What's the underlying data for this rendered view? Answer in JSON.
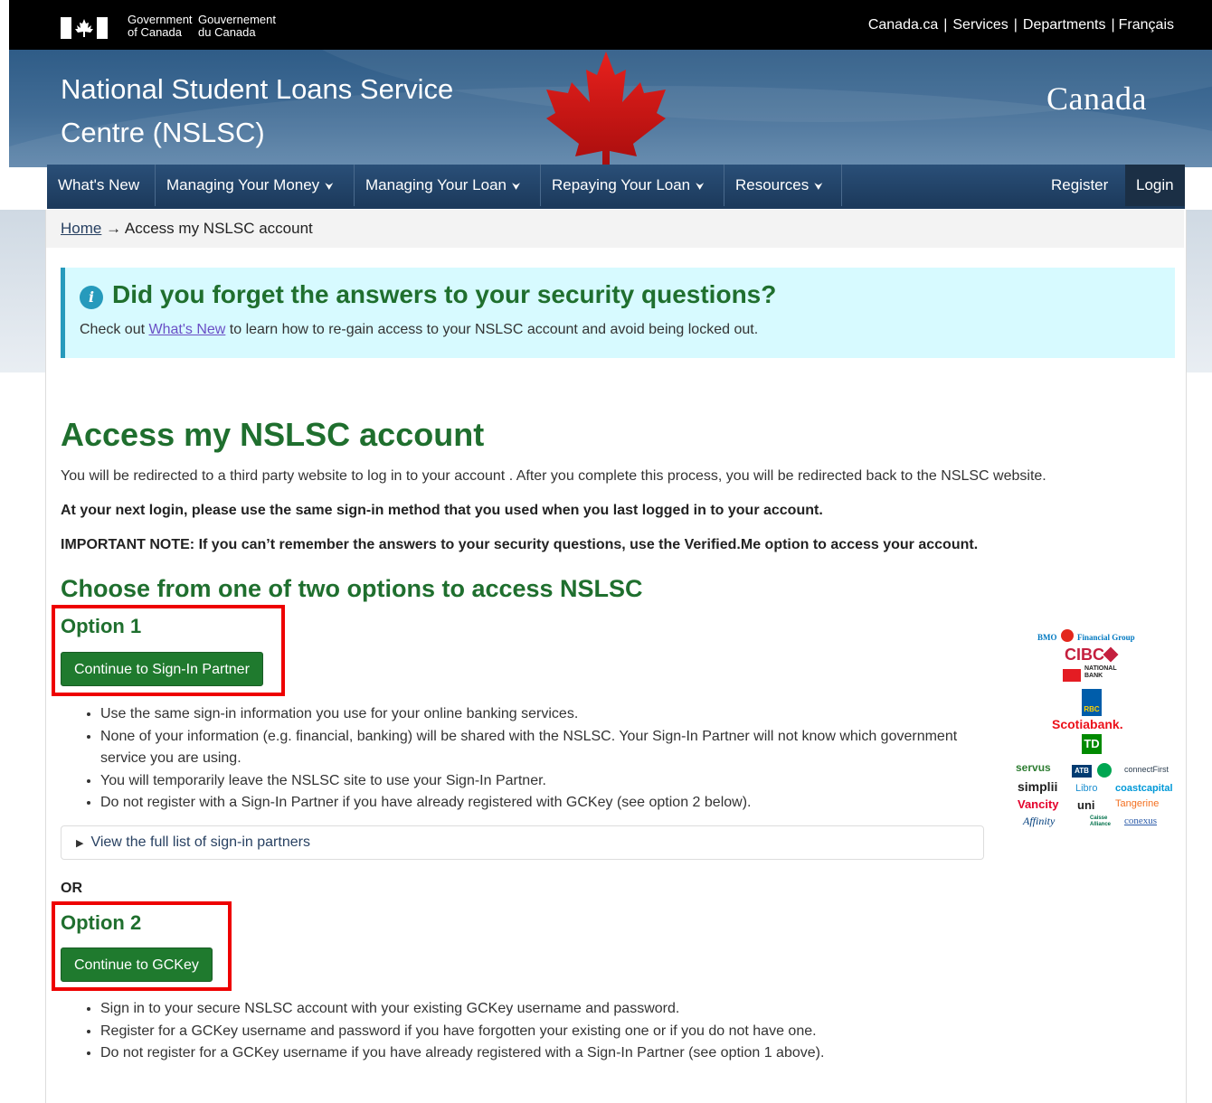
{
  "topbar": {
    "gov_en_line1": "Government",
    "gov_en_line2": "of Canada",
    "gov_fr_line1": "Gouvernement",
    "gov_fr_line2": "du Canada",
    "links": [
      "Canada.ca",
      "Services",
      "Departments",
      "Français"
    ]
  },
  "banner": {
    "title_line1": "National Student Loans Service",
    "title_line2": "Centre (NSLSC)",
    "wordmark": "Canada"
  },
  "nav": {
    "items": [
      "What's New",
      "Managing Your Money",
      "Managing Your Loan",
      "Repaying Your Loan",
      "Resources"
    ],
    "register": "Register",
    "login": "Login"
  },
  "breadcrumb": {
    "home": "Home",
    "arrow": "→",
    "current": "Access my NSLSC account"
  },
  "alert": {
    "icon": "i",
    "heading": "Did you forget the answers to your security questions?",
    "text_before": "Check out ",
    "link": "What's New",
    "text_after": " to learn how to re-gain access to your NSLSC account and avoid being locked out."
  },
  "main": {
    "title": "Access my NSLSC account",
    "p1": "You will be redirected to a third party website to log in to your account . After you complete this process, you will be redirected back to the NSLSC website.",
    "p2": "At your next login, please use the same sign-in method that you used when you last logged in to your account.",
    "p3": "IMPORTANT NOTE: If you can’t remember the answers to your security questions, use the Verified.Me option to access your account.",
    "choose_heading": "Choose from one of two options to access NSLSC"
  },
  "option1": {
    "heading": "Option 1",
    "button": "Continue to Sign-In Partner",
    "bullets": [
      "Use the same sign-in information you use for your online banking services.",
      "None of your information (e.g. financial, banking) will be shared with the NSLSC. Your Sign-In Partner will not know which government service you are using.",
      "You will temporarily leave the NSLSC site to use your Sign-In Partner.",
      "Do not register with a Sign-In Partner if you have already registered with GCKey (see option 2 below)."
    ],
    "details_summary": "View the full list of sign-in partners"
  },
  "or_label": "OR",
  "option2": {
    "heading": "Option 2",
    "button": "Continue to GCKey",
    "bullets": [
      "Sign in to your secure NSLSC account with your existing GCKey username and password.",
      "Register for a GCKey username and password if you have forgotten your existing one or if you do not have one.",
      "Do not register for a GCKey username if you have already registered with a Sign-In Partner (see option 1 above)."
    ]
  },
  "partner_logos": {
    "bmo": "BMO",
    "bmo_group": "Financial Group",
    "cibc": "CIBC",
    "national_bank_1": "NATIONAL",
    "national_bank_2": "BANK",
    "rbc": "RBC",
    "scotiabank": "Scotiabank.",
    "td": "TD",
    "servus": "servus",
    "atb": "ATB",
    "connectfirst": "connectFirst",
    "simplii": "simplii",
    "libro": "Libro",
    "coastcapital": "coastcapital",
    "vancity": "Vancity",
    "uni": "uni",
    "tangerine": "Tangerine",
    "affinity": "Affinity",
    "caisse_1": "Caisse",
    "caisse_2": "Alliance",
    "conexus": "conexus"
  },
  "colors": {
    "heading_green": "#1f6f2e",
    "button_green": "#1f7a2e",
    "nav_blue": "#1c3a5c",
    "alert_bg": "#d7faff",
    "highlight_red": "#ee0000"
  }
}
